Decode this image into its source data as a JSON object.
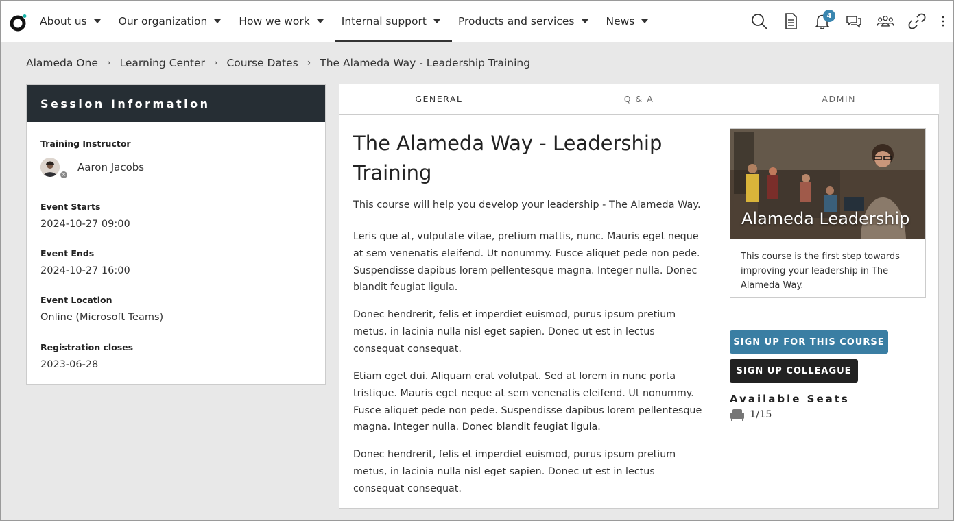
{
  "nav": {
    "items": [
      {
        "label": "About us"
      },
      {
        "label": "Our organization"
      },
      {
        "label": "How we work"
      },
      {
        "label": "Internal support"
      },
      {
        "label": "Products and services"
      },
      {
        "label": "News"
      }
    ],
    "active_index": 3,
    "notification_count": "4",
    "icons": [
      "search-icon",
      "document-icon",
      "bell-icon",
      "chat-icon",
      "people-icon",
      "link-icon",
      "more-vertical-icon"
    ]
  },
  "breadcrumb": {
    "items": [
      "Alameda One",
      "Learning Center",
      "Course Dates"
    ],
    "current": "The Alameda Way - Leadership Training"
  },
  "session": {
    "heading": "Session Information",
    "instructor_label": "Training Instructor",
    "instructor_name": "Aaron Jacobs",
    "starts_label": "Event Starts",
    "starts_value": "2024-10-27 09:00",
    "ends_label": "Event Ends",
    "ends_value": "2024-10-27 16:00",
    "location_label": "Event Location",
    "location_value": "Online (Microsoft Teams)",
    "reg_label": "Registration closes",
    "reg_value": "2023-06-28"
  },
  "tabs": [
    {
      "label": "GENERAL"
    },
    {
      "label": "Q & A"
    },
    {
      "label": "ADMIN"
    }
  ],
  "course": {
    "title": "The Alameda Way - Leadership Training",
    "intro": "This course will help you develop your leadership - The Alameda Way.",
    "paragraphs": [
      "Leris que at, vulputate vitae, pretium mattis, nunc. Mauris eget neque at sem venenatis eleifend. Ut nonummy. Fusce aliquet pede non pede. Suspendisse dapibus lorem pellentesque magna. Integer nulla. Donec blandit feugiat ligula.",
      "Donec hendrerit, felis et imperdiet euismod, purus ipsum pretium metus, in lacinia nulla nisl eget sapien. Donec ut est in lectus consequat consequat.",
      "Etiam eget dui. Aliquam erat volutpat. Sed at lorem in nunc porta tristique. Mauris eget neque at sem venenatis eleifend. Ut nonummy. Fusce aliquet pede non pede. Suspendisse dapibus lorem pellentesque magna. Integer nulla. Donec blandit feugiat ligula.",
      "Donec hendrerit, felis et imperdiet euismod, purus ipsum pretium metus, in lacinia nulla nisl eget sapien. Donec ut est in lectus consequat consequat."
    ]
  },
  "card": {
    "image_title": "Alameda Leadership",
    "text": "This course is the first step towards improving your leadership in The Alameda Way."
  },
  "actions": {
    "signup": "SIGN UP FOR THIS COURSE",
    "signup_colleague": "SIGN UP COLLEAGUE"
  },
  "seats": {
    "title": "Available Seats",
    "value": "1/15"
  },
  "colors": {
    "primary": "#3a7ea3",
    "dark": "#262e34",
    "badge": "#3a86b0"
  }
}
